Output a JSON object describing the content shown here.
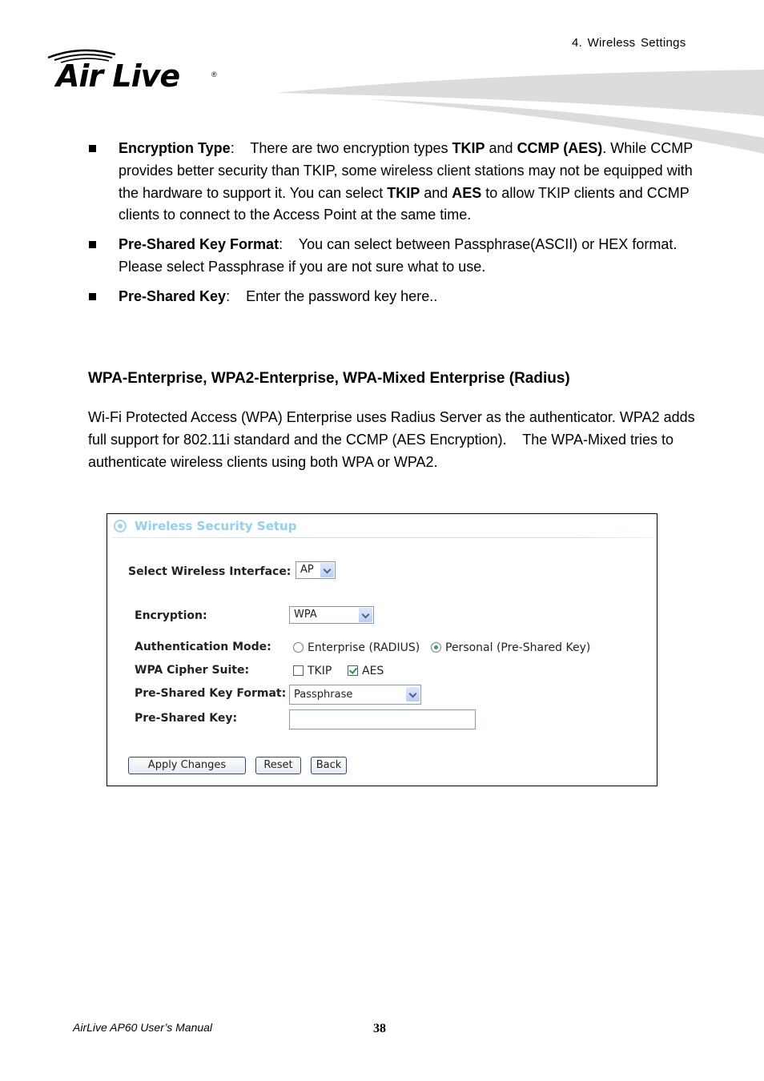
{
  "header": {
    "chapter": "4.  Wireless  Settings",
    "logo_text": "Air Live",
    "logo_registered": "®"
  },
  "bullets": [
    {
      "term": "Encryption Type",
      "sep": ":    ",
      "parts": [
        {
          "t": "There are two encryption types ",
          "b": false
        },
        {
          "t": "TKIP",
          "b": true
        },
        {
          "t": " and ",
          "b": false
        },
        {
          "t": "CCMP (AES)",
          "b": true
        },
        {
          "t": ". While CCMP provides better security than TKIP, some wireless client stations may not be equipped with the hardware to support it. You can select ",
          "b": false
        },
        {
          "t": "TKIP",
          "b": true
        },
        {
          "t": " and ",
          "b": false
        },
        {
          "t": "AES",
          "b": true
        },
        {
          "t": " to allow TKIP clients and CCMP clients to connect to the Access Point at the same time.",
          "b": false
        }
      ]
    },
    {
      "term": "Pre-Shared Key Format",
      "sep": ":    ",
      "parts": [
        {
          "t": "You can select between Passphrase(ASCII) or HEX format.    Please select Passphrase if you are not sure what to use.",
          "b": false
        }
      ]
    },
    {
      "term": "Pre-Shared Key",
      "sep": ":    ",
      "parts": [
        {
          "t": "Enter the password key here..",
          "b": false
        }
      ]
    }
  ],
  "section": {
    "title": "WPA-Enterprise, WPA2-Enterprise, WPA-Mixed Enterprise (Radius)",
    "paragraph": "Wi-Fi Protected Access (WPA) Enterprise uses Radius Server as the authenticator. WPA2 adds full support for 802.11i standard and the CCMP (AES Encryption).    The WPA-Mixed tries to authenticate wireless clients using both WPA or WPA2."
  },
  "panel": {
    "title": "Wireless Security Setup",
    "interface_label": "Select Wireless Interface:",
    "interface_value": "AP",
    "encryption_label": "Encryption:",
    "encryption_value": "WPA",
    "auth_label": "Authentication Mode:",
    "auth_options": [
      {
        "label": "Enterprise (RADIUS)",
        "selected": false
      },
      {
        "label": "Personal (Pre-Shared Key)",
        "selected": true
      }
    ],
    "cipher_label": "WPA Cipher Suite:",
    "cipher_options": [
      {
        "label": "TKIP",
        "checked": false
      },
      {
        "label": "AES",
        "checked": true
      }
    ],
    "psk_format_label": "Pre-Shared Key Format:",
    "psk_format_value": "Passphrase",
    "psk_label": "Pre-Shared Key:",
    "psk_value": "",
    "buttons": {
      "apply": "Apply Changes",
      "reset": "Reset",
      "back": "Back"
    },
    "colors": {
      "title": "#8fd1f2",
      "check": "#1e9c3a",
      "radio_dot": "#2fa84f"
    }
  },
  "footer": {
    "manual": "AirLive AP60 User’s Manual",
    "page": "38"
  }
}
